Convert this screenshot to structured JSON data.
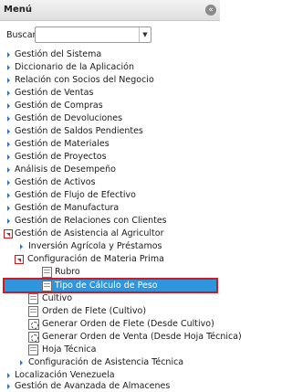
{
  "header": {
    "title": "Menú",
    "collapse_icon": "collapse-left-icon",
    "collapse_glyph": "«"
  },
  "search": {
    "label": "Buscar:",
    "value": "",
    "dropdown_glyph": "▼"
  },
  "tree": [
    {
      "label": "Gestión del Sistema",
      "icon": "arrow-right-icon"
    },
    {
      "label": "Diccionario de la Aplicación",
      "icon": "arrow-right-icon"
    },
    {
      "label": "Relación con Socios del Negocio",
      "icon": "arrow-right-icon"
    },
    {
      "label": "Gestión de Ventas",
      "icon": "arrow-right-icon"
    },
    {
      "label": "Gestión de Compras",
      "icon": "arrow-right-icon"
    },
    {
      "label": "Gestión de Devoluciones",
      "icon": "arrow-right-icon"
    },
    {
      "label": "Gestión de Saldos Pendientes",
      "icon": "arrow-right-icon"
    },
    {
      "label": "Gestión de Materiales",
      "icon": "arrow-right-icon"
    },
    {
      "label": "Gestión de Proyectos",
      "icon": "arrow-right-icon"
    },
    {
      "label": "Análisis de Desempeño",
      "icon": "arrow-right-icon"
    },
    {
      "label": "Gestión de Activos",
      "icon": "arrow-right-icon"
    },
    {
      "label": "Gestión de Flujo de Efectivo",
      "icon": "arrow-right-icon"
    },
    {
      "label": "Gestión de Manufactura",
      "icon": "arrow-right-icon"
    },
    {
      "label": "Gestión de Relaciones con Clientes",
      "icon": "arrow-right-icon"
    },
    {
      "label": "Gestión de Asistencia al Agricultor",
      "icon": "arrow-down-icon"
    },
    {
      "label": "Inversión Agrícola y Préstamos",
      "icon": "arrow-right-icon"
    },
    {
      "label": "Configuración de Materia Prima",
      "icon": "arrow-down-icon"
    },
    {
      "label": "Rubro",
      "icon": "document-icon"
    },
    {
      "label": "Tipo de Cálculo de Peso",
      "icon": "document-icon",
      "selected": true
    },
    {
      "label": "Cultivo",
      "icon": "document-icon"
    },
    {
      "label": "Orden de Flete (Cultivo)",
      "icon": "document-icon"
    },
    {
      "label": "Generar Orden de Flete (Desde Cultivo)",
      "icon": "process-icon"
    },
    {
      "label": "Generar Orden de Venta (Desde Hoja Técnica)",
      "icon": "process-icon"
    },
    {
      "label": "Hoja Técnica",
      "icon": "document-icon"
    },
    {
      "label": "Configuración de Asistencia Técnica",
      "icon": "arrow-right-icon"
    },
    {
      "label": "Localización Venezuela",
      "icon": "arrow-right-icon"
    },
    {
      "label": "Gestión de Avanzada de Almacenes",
      "icon": "arrow-right-icon"
    }
  ]
}
